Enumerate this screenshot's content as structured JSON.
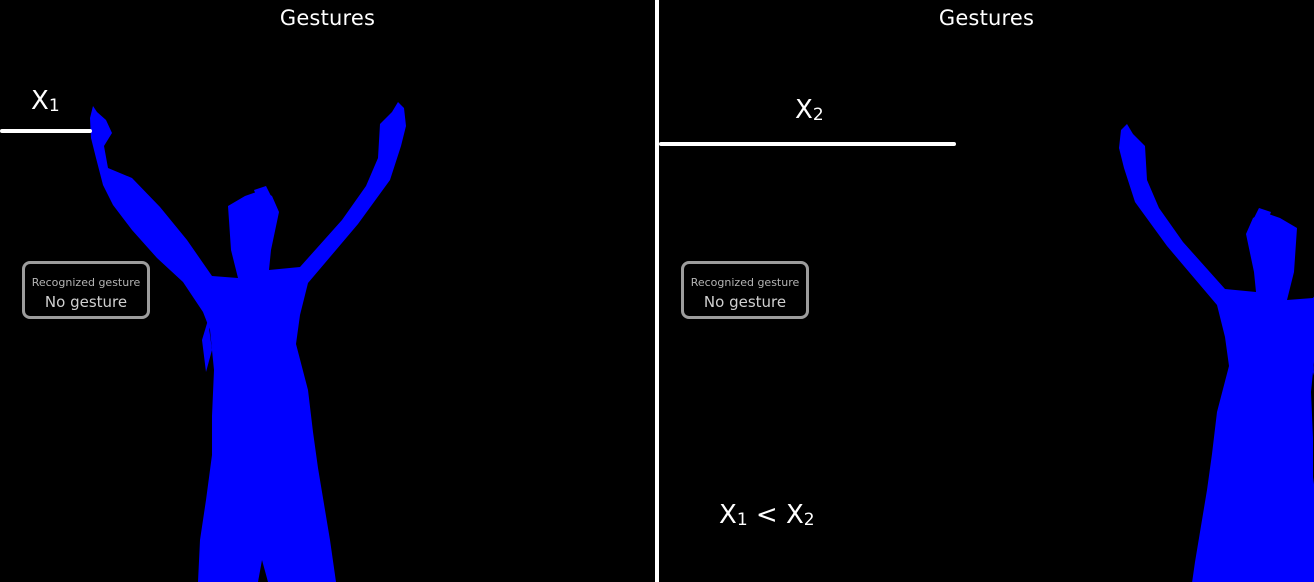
{
  "panels": [
    {
      "title": "Gestures",
      "gesture_box": {
        "caption": "Recognized gesture",
        "value": "No gesture"
      },
      "marker": {
        "symbol": "X",
        "subscript": "1"
      }
    },
    {
      "title": "Gestures",
      "gesture_box": {
        "caption": "Recognized gesture",
        "value": "No gesture"
      },
      "marker": {
        "symbol": "X",
        "subscript": "2"
      },
      "comparison": {
        "left_symbol": "X",
        "left_subscript": "1",
        "operator": "<",
        "right_symbol": "X",
        "right_subscript": "2"
      }
    }
  ],
  "colors": {
    "background": "#000000",
    "silhouette": "#0000ff",
    "text": "#ffffff",
    "box_border": "#9c9c9c",
    "divider": "#ffffff"
  },
  "icons": {
    "silhouette": "person-arms-raised-icon"
  }
}
